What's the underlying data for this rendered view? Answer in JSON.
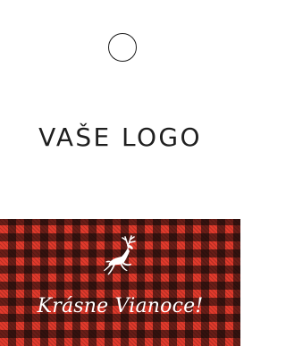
{
  "tag": {
    "logo_text": "VAŠE LOGO",
    "greeting_text": "Krásne Vianoce!",
    "punch_hole_icon": "circle-outline-icon",
    "illustration_icon": "leaping-reindeer-icon",
    "pattern": "buffalo-check-plaid"
  },
  "colors": {
    "background": "#ffffff",
    "plaid_red": "#e23a2c",
    "plaid_black": "#0b0b0b",
    "text_dark": "#1f1f1f",
    "text_light": "#ffffff"
  }
}
